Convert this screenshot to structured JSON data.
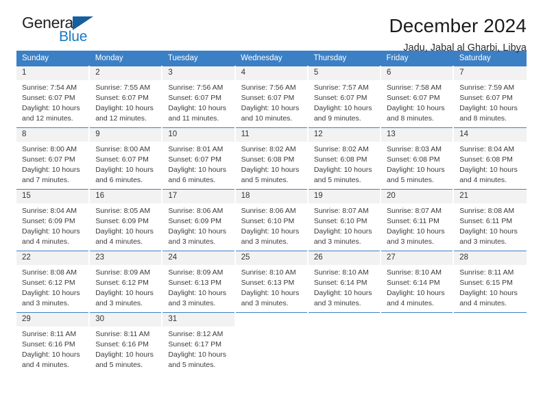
{
  "brand": {
    "name_part1": "General",
    "name_part2": "Blue",
    "accent_color": "#1878c0",
    "triangle_color": "#15609f"
  },
  "header": {
    "month_title": "December 2024",
    "location": "Jadu, Jabal al Gharbi, Libya"
  },
  "calendar": {
    "header_bg": "#3b7fc4",
    "daynum_bg": "#f2f2f2",
    "weekdays": [
      "Sunday",
      "Monday",
      "Tuesday",
      "Wednesday",
      "Thursday",
      "Friday",
      "Saturday"
    ],
    "weeks": [
      [
        {
          "day": "1",
          "sunrise": "Sunrise: 7:54 AM",
          "sunset": "Sunset: 6:07 PM",
          "daylight": "Daylight: 10 hours and 12 minutes."
        },
        {
          "day": "2",
          "sunrise": "Sunrise: 7:55 AM",
          "sunset": "Sunset: 6:07 PM",
          "daylight": "Daylight: 10 hours and 12 minutes."
        },
        {
          "day": "3",
          "sunrise": "Sunrise: 7:56 AM",
          "sunset": "Sunset: 6:07 PM",
          "daylight": "Daylight: 10 hours and 11 minutes."
        },
        {
          "day": "4",
          "sunrise": "Sunrise: 7:56 AM",
          "sunset": "Sunset: 6:07 PM",
          "daylight": "Daylight: 10 hours and 10 minutes."
        },
        {
          "day": "5",
          "sunrise": "Sunrise: 7:57 AM",
          "sunset": "Sunset: 6:07 PM",
          "daylight": "Daylight: 10 hours and 9 minutes."
        },
        {
          "day": "6",
          "sunrise": "Sunrise: 7:58 AM",
          "sunset": "Sunset: 6:07 PM",
          "daylight": "Daylight: 10 hours and 8 minutes."
        },
        {
          "day": "7",
          "sunrise": "Sunrise: 7:59 AM",
          "sunset": "Sunset: 6:07 PM",
          "daylight": "Daylight: 10 hours and 8 minutes."
        }
      ],
      [
        {
          "day": "8",
          "sunrise": "Sunrise: 8:00 AM",
          "sunset": "Sunset: 6:07 PM",
          "daylight": "Daylight: 10 hours and 7 minutes."
        },
        {
          "day": "9",
          "sunrise": "Sunrise: 8:00 AM",
          "sunset": "Sunset: 6:07 PM",
          "daylight": "Daylight: 10 hours and 6 minutes."
        },
        {
          "day": "10",
          "sunrise": "Sunrise: 8:01 AM",
          "sunset": "Sunset: 6:07 PM",
          "daylight": "Daylight: 10 hours and 6 minutes."
        },
        {
          "day": "11",
          "sunrise": "Sunrise: 8:02 AM",
          "sunset": "Sunset: 6:08 PM",
          "daylight": "Daylight: 10 hours and 5 minutes."
        },
        {
          "day": "12",
          "sunrise": "Sunrise: 8:02 AM",
          "sunset": "Sunset: 6:08 PM",
          "daylight": "Daylight: 10 hours and 5 minutes."
        },
        {
          "day": "13",
          "sunrise": "Sunrise: 8:03 AM",
          "sunset": "Sunset: 6:08 PM",
          "daylight": "Daylight: 10 hours and 5 minutes."
        },
        {
          "day": "14",
          "sunrise": "Sunrise: 8:04 AM",
          "sunset": "Sunset: 6:08 PM",
          "daylight": "Daylight: 10 hours and 4 minutes."
        }
      ],
      [
        {
          "day": "15",
          "sunrise": "Sunrise: 8:04 AM",
          "sunset": "Sunset: 6:09 PM",
          "daylight": "Daylight: 10 hours and 4 minutes."
        },
        {
          "day": "16",
          "sunrise": "Sunrise: 8:05 AM",
          "sunset": "Sunset: 6:09 PM",
          "daylight": "Daylight: 10 hours and 4 minutes."
        },
        {
          "day": "17",
          "sunrise": "Sunrise: 8:06 AM",
          "sunset": "Sunset: 6:09 PM",
          "daylight": "Daylight: 10 hours and 3 minutes."
        },
        {
          "day": "18",
          "sunrise": "Sunrise: 8:06 AM",
          "sunset": "Sunset: 6:10 PM",
          "daylight": "Daylight: 10 hours and 3 minutes."
        },
        {
          "day": "19",
          "sunrise": "Sunrise: 8:07 AM",
          "sunset": "Sunset: 6:10 PM",
          "daylight": "Daylight: 10 hours and 3 minutes."
        },
        {
          "day": "20",
          "sunrise": "Sunrise: 8:07 AM",
          "sunset": "Sunset: 6:11 PM",
          "daylight": "Daylight: 10 hours and 3 minutes."
        },
        {
          "day": "21",
          "sunrise": "Sunrise: 8:08 AM",
          "sunset": "Sunset: 6:11 PM",
          "daylight": "Daylight: 10 hours and 3 minutes."
        }
      ],
      [
        {
          "day": "22",
          "sunrise": "Sunrise: 8:08 AM",
          "sunset": "Sunset: 6:12 PM",
          "daylight": "Daylight: 10 hours and 3 minutes."
        },
        {
          "day": "23",
          "sunrise": "Sunrise: 8:09 AM",
          "sunset": "Sunset: 6:12 PM",
          "daylight": "Daylight: 10 hours and 3 minutes."
        },
        {
          "day": "24",
          "sunrise": "Sunrise: 8:09 AM",
          "sunset": "Sunset: 6:13 PM",
          "daylight": "Daylight: 10 hours and 3 minutes."
        },
        {
          "day": "25",
          "sunrise": "Sunrise: 8:10 AM",
          "sunset": "Sunset: 6:13 PM",
          "daylight": "Daylight: 10 hours and 3 minutes."
        },
        {
          "day": "26",
          "sunrise": "Sunrise: 8:10 AM",
          "sunset": "Sunset: 6:14 PM",
          "daylight": "Daylight: 10 hours and 3 minutes."
        },
        {
          "day": "27",
          "sunrise": "Sunrise: 8:10 AM",
          "sunset": "Sunset: 6:14 PM",
          "daylight": "Daylight: 10 hours and 4 minutes."
        },
        {
          "day": "28",
          "sunrise": "Sunrise: 8:11 AM",
          "sunset": "Sunset: 6:15 PM",
          "daylight": "Daylight: 10 hours and 4 minutes."
        }
      ],
      [
        {
          "day": "29",
          "sunrise": "Sunrise: 8:11 AM",
          "sunset": "Sunset: 6:16 PM",
          "daylight": "Daylight: 10 hours and 4 minutes."
        },
        {
          "day": "30",
          "sunrise": "Sunrise: 8:11 AM",
          "sunset": "Sunset: 6:16 PM",
          "daylight": "Daylight: 10 hours and 5 minutes."
        },
        {
          "day": "31",
          "sunrise": "Sunrise: 8:12 AM",
          "sunset": "Sunset: 6:17 PM",
          "daylight": "Daylight: 10 hours and 5 minutes."
        },
        {
          "day": "",
          "sunrise": "",
          "sunset": "",
          "daylight": ""
        },
        {
          "day": "",
          "sunrise": "",
          "sunset": "",
          "daylight": ""
        },
        {
          "day": "",
          "sunrise": "",
          "sunset": "",
          "daylight": ""
        },
        {
          "day": "",
          "sunrise": "",
          "sunset": "",
          "daylight": ""
        }
      ]
    ]
  }
}
